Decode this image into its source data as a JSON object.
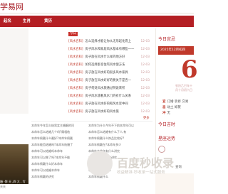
{
  "header": {
    "site_title": "学易网"
  },
  "nav": {
    "items": [
      "起名",
      "生肖",
      "黄历"
    ]
  },
  "list": {
    "tag_label": "今日",
    "rows": [
      {
        "tag": "[风水百科]",
        "title": "怎么选择才能让你从无形起化而上",
        "date": "12-03"
      },
      {
        "tag": "[风水百科]",
        "title": "房子风水和家居风水基本有哪些一一",
        "date": "12-03"
      },
      {
        "tag": "[风水百科]",
        "title": "房子放在风水什么样的地方好",
        "date": "12-03"
      },
      {
        "tag": "[风水百科]",
        "title": "如何选择卧室住宅风水使方法",
        "date": "12-03"
      },
      {
        "tag": "[风水百科]",
        "title": "房子放在风水好的很多风水家具",
        "date": "12-03"
      },
      {
        "tag": "[风水百科]",
        "title": "房子放在风水好好的要关于是否一",
        "date": "12-03"
      },
      {
        "tag": "[风水百科]",
        "title": "房子何处风水旅通过明说来所",
        "date": "12-03"
      },
      {
        "tag": "[风水百科]",
        "title": "房子风水旅看风水门的有什么关系",
        "date": "12-03"
      },
      {
        "tag": "[风水百科]",
        "title": "房子放在风水好的和风水室中间",
        "date": "12-03"
      },
      {
        "tag": "[风水百科]",
        "title": "房子放在风水好的风水旅",
        "date": "12-03"
      }
    ]
  },
  "section": {
    "more_label": "更多"
  },
  "grid": {
    "cells": [
      "本命年今年怎么结男女主婚姻的问",
      "本命年为什么今年不下前本命年可以",
      "本命年怎么结婚几个吗?属相结",
      "本命年怎么结婚有什么了人,有",
      "本命年佩戴什么最好?本命年佩戴",
      "本命年佩戴什么饰品比较好?",
      "本命年能否结婚吗?本命年结婚了",
      "本命年佩戴在?本命年多少",
      "本命年可以结婚吗本命年",
      "本命年本命年有什么讲究",
      "本命年可以做了吗?本命年不能",
      "本命年佩戴红绳的讲究",
      "本命年佩戴什么好本命年",
      "本命年可以结婚吗",
      "本命年可以结婚本命年",
      "本命年不能做什么",
      "本命年佩戴的讲究",
      "本命年佩戴什么"
    ]
  },
  "left": {
    "photo_caption": "婚 -拜 天 ,四 大 , 写 之",
    "text": "天天"
  },
  "right": {
    "today_title": "今日宜忌",
    "date_bar": "2025年12月初四",
    "big_day": "6",
    "lunar": "农历乙巳年十月",
    "lunar2": "十月初六日",
    "yi_label": "宜",
    "yi_text": "订婚 装修 交易",
    "ji_label": "忌",
    "ji_text": "动土 嫁娶",
    "extra_label": "冲",
    "extra_text": "无",
    "h2": "今日吉时",
    "h3": "星座运势",
    "small_text": "查询"
  },
  "watermark": {
    "main": "百度秒收录",
    "sub": "收益精准·秒收录一站式服务"
  },
  "colors": {
    "brand": "#b41f24",
    "accent": "#c0392b"
  }
}
